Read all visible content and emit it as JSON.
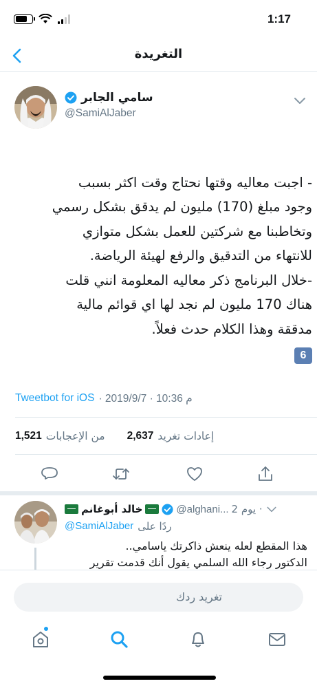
{
  "status": {
    "time": "1:17"
  },
  "nav": {
    "title": "التغريدة"
  },
  "tweet": {
    "author_name": "سامي الجابر",
    "author_handle": "@SamiAlJaber",
    "text": "- اجبت معاليه وقتها نحتاج وقت اكثر بسبب\nوجود مبلغ (170) مليون لم يدقق بشكل رسمي\nوتخاطبنا مع شركتين للعمل بشكل متوازي\nللانتهاء من التدقيق والرفع لهيئة الرياضة.\n-خلال البرنامج ذكر معاليه المعلومة انني قلت\nهناك 170 مليون لم نجد لها اي قوائم مالية\nمدققة وهذا الكلام حدث فعلاً.",
    "thread_number": "6",
    "source": "Tweetbot for iOS",
    "timestamp": "· 2019/9/7 · 10:36 م",
    "retweets_count": "1,521",
    "retweets_label": "من الإعجابات",
    "likes_count": "2,637",
    "likes_label": "إعادات تغريد"
  },
  "reply": {
    "author_name": "خالد أبوغانم",
    "author_handle": "@alghani...",
    "time": "2 يوم ·",
    "reply_to_label": "ردًا على",
    "reply_to_handle": "@SamiAlJaber",
    "text": "هذا المقطع لعله ينعش ذاكرتك ياسامي..\nالدكتور رجاء الله السلمي يقول أنك قدمت تقرير"
  },
  "composer": {
    "placeholder": "تغريد ردك"
  },
  "tabs": [
    "home-icon",
    "search-icon",
    "notifications-icon",
    "messages-icon"
  ],
  "colors": {
    "accent": "#1da1f2",
    "text": "#14171a",
    "muted": "#657786"
  }
}
